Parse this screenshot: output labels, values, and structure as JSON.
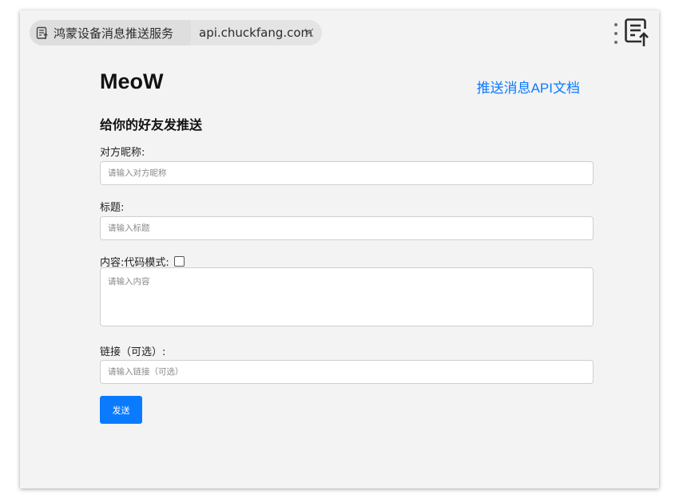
{
  "browser": {
    "tab_title": "鸿蒙设备消息推送服务",
    "tab_url": "api.chuckfang.com"
  },
  "page": {
    "title": "MeoW",
    "doc_link": "推送消息API文档",
    "subtitle": "给你的好友发推送"
  },
  "form": {
    "nickname_label": "对方昵称:",
    "nickname_placeholder": "请输入对方昵称",
    "title_label": "标题:",
    "title_placeholder": "请输入标题",
    "content_label": "内容:",
    "code_mode_label": "代码模式:",
    "code_mode_checked": false,
    "content_placeholder": "请输入内容",
    "link_label": "链接（可选）:",
    "link_placeholder": "请输入链接（可选）",
    "send_label": "发送"
  },
  "colors": {
    "accent": "#0a7bff",
    "background": "#f3f3f3"
  }
}
